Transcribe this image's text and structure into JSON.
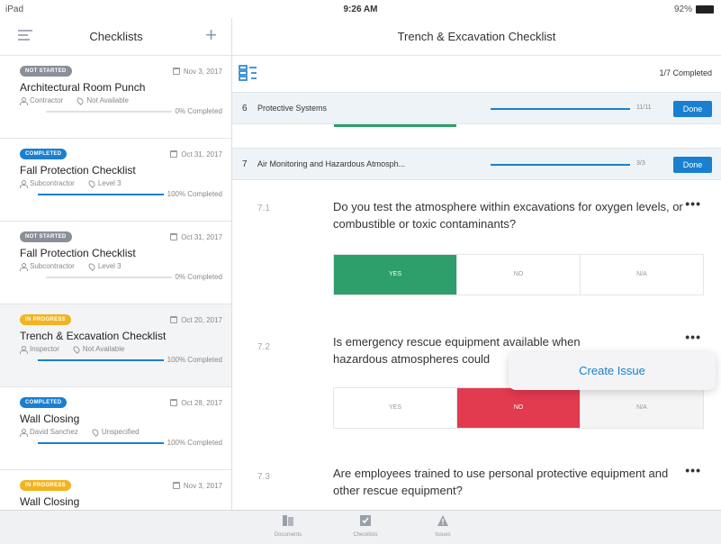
{
  "status_bar": {
    "device": "iPad",
    "time": "9:26 AM",
    "battery": "92%"
  },
  "left": {
    "title": "Checklists",
    "items": [
      {
        "status": "NOT STARTED",
        "status_color": "#8a8f98",
        "date": "Nov 3, 2017",
        "name": "Architectural Room Punch",
        "role": "Contractor",
        "location": "Not Available",
        "progress": 0,
        "progress_label": "0% Completed"
      },
      {
        "status": "COMPLETED",
        "status_color": "#1a7fcf",
        "date": "Oct 31, 2017",
        "name": "Fall Protection Checklist",
        "role": "Subcontractor",
        "location": "Level 3",
        "progress": 100,
        "progress_label": "100% Completed"
      },
      {
        "status": "NOT STARTED",
        "status_color": "#8a8f98",
        "date": "Oct 31, 2017",
        "name": "Fall Protection Checklist",
        "role": "Subcontractor",
        "location": "Level 3",
        "progress": 0,
        "progress_label": "0% Completed"
      },
      {
        "status": "IN PROGRESS",
        "status_color": "#f2b420",
        "date": "Oct 20, 2017",
        "name": "Trench & Excavation Checklist",
        "role": "Inspector",
        "location": "Not Available",
        "progress": 100,
        "progress_label": "100% Completed"
      },
      {
        "status": "COMPLETED",
        "status_color": "#1a7fcf",
        "date": "Oct 28, 2017",
        "name": "Wall Closing",
        "role": "David Sanchez",
        "location": "Unspecified",
        "progress": 100,
        "progress_label": "100% Completed"
      },
      {
        "status": "IN PROGRESS",
        "status_color": "#f2b420",
        "date": "Nov 3, 2017",
        "name": "Wall Closing",
        "role": "",
        "location": "",
        "progress": 0,
        "progress_label": ""
      }
    ]
  },
  "right": {
    "title": "Trench & Excavation Checklist",
    "completed": "1/7 Completed",
    "sections": [
      {
        "num": "6",
        "label": "Protective Systems",
        "fraction": "11/11",
        "done": "Done"
      },
      {
        "num": "7",
        "label": "Air Monitoring and Hazardous Atmosph...",
        "fraction": "3/3",
        "done": "Done"
      }
    ],
    "questions": [
      {
        "num": "7.1",
        "text": "Do you test the atmosphere within excavations for oxygen levels, or combustible or toxic contaminants?",
        "more": "•••"
      },
      {
        "num": "7.2",
        "text": "Is emergency rescue equipment available when hazardous atmospheres could",
        "more": "•••"
      },
      {
        "num": "7.3",
        "text": "Are employees trained to use personal protective equipment and other rescue equipment?",
        "more": "•••"
      }
    ],
    "answers": {
      "yes": "YES",
      "no": "NO",
      "na": "N/A"
    },
    "popover": "Create Issue"
  },
  "tabs": [
    {
      "label": "Documents"
    },
    {
      "label": "Checklists"
    },
    {
      "label": "Issues"
    }
  ]
}
